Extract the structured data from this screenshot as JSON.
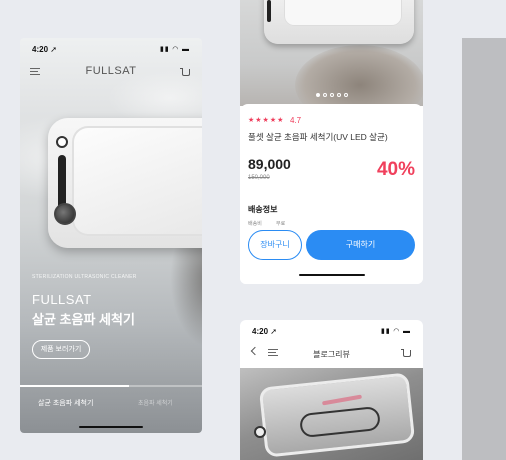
{
  "colors": {
    "accent": "#2b8cf3",
    "sale": "#f0405c",
    "rating": "#ef3e5c",
    "background": "#e9ebf0"
  },
  "phone_main": {
    "status": {
      "time": "4:20 ➚",
      "icons": "▮▮ ◠ ▬"
    },
    "nav": {
      "menu_icon": "menu-icon",
      "brand": "FULLSAT",
      "cart_icon": "cart-icon"
    },
    "hero": {
      "subtitle": "STERILIZATION ULTRASONIC CLEANER",
      "brand": "FULLSAT",
      "title": "살균 초음파 세척기",
      "button": "제품 보러가기"
    },
    "slide_progress": 0.6,
    "tabs": [
      "살균 초음파 세척기",
      "초음파 세척기"
    ]
  },
  "phone_product": {
    "carousel": {
      "count": 5,
      "active": 0
    },
    "stars": "★★★★★",
    "rating": "4.7",
    "name": "풀셋 살균 초음파 세척기(UV LED 살균)",
    "price": "89,000",
    "original_price": "150,000",
    "discount": "40%",
    "shipping_title": "배송정보",
    "shipping_label": "배송비",
    "shipping_value": "무료",
    "cart_button": "장바구니",
    "buy_button": "구매하기"
  },
  "phone_review": {
    "status": {
      "time": "4:20 ➚",
      "icons": "▮▮ ◠ ▬"
    },
    "nav": {
      "back_icon": "back-icon",
      "menu_icon": "menu-icon",
      "title": "블로그리뷰",
      "cart_icon": "cart-icon"
    }
  }
}
